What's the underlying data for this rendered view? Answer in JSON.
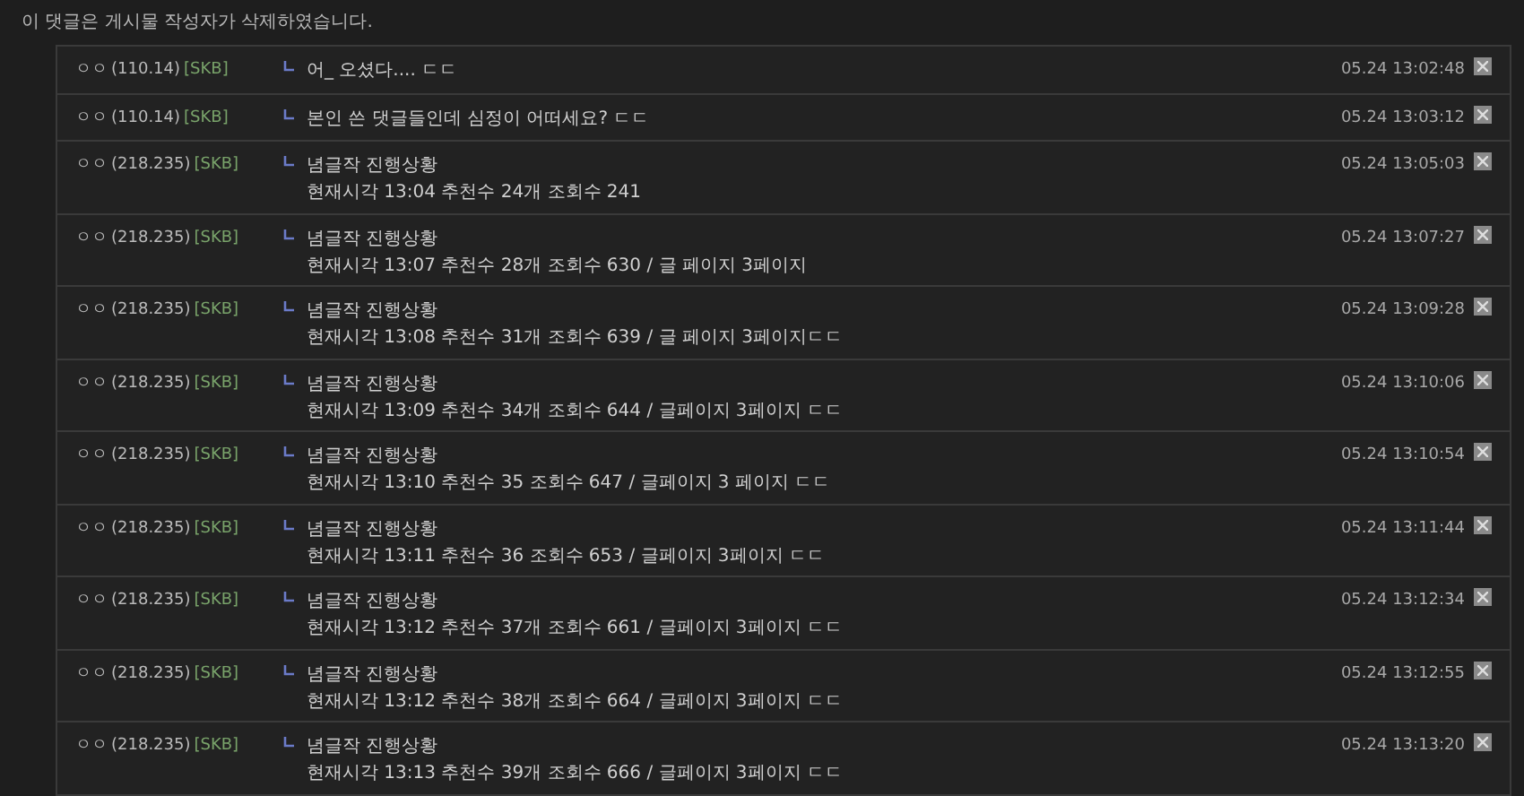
{
  "notice": "이 댓글은 게시물 작성자가 삭제하였습니다.",
  "comments": [
    {
      "author": "ㅇㅇ",
      "ip": "(110.14)",
      "tag": "[SKB]",
      "lines": [
        "어_ 오셨다.... ㄷㄷ"
      ],
      "time": "05.24 13:02:48"
    },
    {
      "author": "ㅇㅇ",
      "ip": "(110.14)",
      "tag": "[SKB]",
      "lines": [
        "본인 쓴 댓글들인데 심정이 어떠세요? ㄷㄷ"
      ],
      "time": "05.24 13:03:12"
    },
    {
      "author": "ㅇㅇ",
      "ip": "(218.235)",
      "tag": "[SKB]",
      "lines": [
        "념글작 진행상황",
        "현재시각 13:04 추천수 24개 조회수 241"
      ],
      "time": "05.24 13:05:03"
    },
    {
      "author": "ㅇㅇ",
      "ip": "(218.235)",
      "tag": "[SKB]",
      "lines": [
        "념글작 진행상황",
        "현재시각 13:07 추천수 28개 조회수 630 / 글 페이지 3페이지"
      ],
      "time": "05.24 13:07:27"
    },
    {
      "author": "ㅇㅇ",
      "ip": "(218.235)",
      "tag": "[SKB]",
      "lines": [
        "념글작 진행상황",
        "현재시각 13:08 추천수 31개 조회수 639 / 글 페이지 3페이지ㄷㄷ"
      ],
      "time": "05.24 13:09:28"
    },
    {
      "author": "ㅇㅇ",
      "ip": "(218.235)",
      "tag": "[SKB]",
      "lines": [
        "념글작 진행상황",
        "현재시각 13:09 추천수 34개 조회수 644 / 글페이지 3페이지 ㄷㄷ"
      ],
      "time": "05.24 13:10:06"
    },
    {
      "author": "ㅇㅇ",
      "ip": "(218.235)",
      "tag": "[SKB]",
      "lines": [
        "념글작 진행상황",
        "현재시각 13:10 추천수 35 조회수 647 / 글페이지 3 페이지 ㄷㄷ"
      ],
      "time": "05.24 13:10:54"
    },
    {
      "author": "ㅇㅇ",
      "ip": "(218.235)",
      "tag": "[SKB]",
      "lines": [
        "념글작 진행상황",
        "현재시각 13:11 추천수 36 조회수 653 / 글페이지 3페이지 ㄷㄷ"
      ],
      "time": "05.24 13:11:44"
    },
    {
      "author": "ㅇㅇ",
      "ip": "(218.235)",
      "tag": "[SKB]",
      "lines": [
        "념글작 진행상황",
        "현재시각 13:12 추천수 37개 조회수 661 / 글페이지 3페이지 ㄷㄷ"
      ],
      "time": "05.24 13:12:34"
    },
    {
      "author": "ㅇㅇ",
      "ip": "(218.235)",
      "tag": "[SKB]",
      "lines": [
        "념글작 진행상황",
        "현재시각 13:12 추천수 38개 조회수 664 / 글페이지 3페이지 ㄷㄷ"
      ],
      "time": "05.24 13:12:55"
    },
    {
      "author": "ㅇㅇ",
      "ip": "(218.235)",
      "tag": "[SKB]",
      "lines": [
        "념글작 진행상황",
        "현재시각 13:13 추천수 39개 조회수 666 / 글페이지 3페이지 ㄷㄷ"
      ],
      "time": "05.24 13:13:20"
    }
  ]
}
